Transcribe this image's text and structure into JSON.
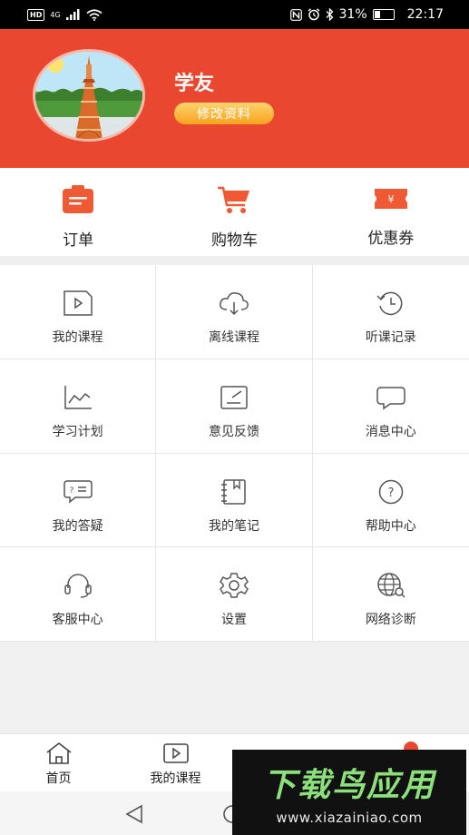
{
  "status_bar": {
    "network": "4G",
    "battery_percent": "31%",
    "battery_level": 0.31,
    "time": "22:17"
  },
  "profile": {
    "username": "学友",
    "edit_label": "修改资料"
  },
  "quick_actions": [
    {
      "label": "订单",
      "icon": "order-icon"
    },
    {
      "label": "购物车",
      "icon": "cart-icon"
    },
    {
      "label": "优惠券",
      "icon": "coupon-icon"
    }
  ],
  "grid": [
    {
      "label": "我的课程",
      "icon": "course-play-icon"
    },
    {
      "label": "离线课程",
      "icon": "cloud-download-icon"
    },
    {
      "label": "听课记录",
      "icon": "history-clock-icon"
    },
    {
      "label": "学习计划",
      "icon": "chart-line-icon"
    },
    {
      "label": "意见反馈",
      "icon": "feedback-edit-icon"
    },
    {
      "label": "消息中心",
      "icon": "message-bubble-icon"
    },
    {
      "label": "我的答疑",
      "icon": "qa-bubble-icon"
    },
    {
      "label": "我的笔记",
      "icon": "notebook-icon"
    },
    {
      "label": "帮助中心",
      "icon": "help-question-icon"
    },
    {
      "label": "客服中心",
      "icon": "headset-icon"
    },
    {
      "label": "设置",
      "icon": "gear-icon"
    },
    {
      "label": "网络诊断",
      "icon": "globe-search-icon"
    }
  ],
  "bottom_nav": [
    {
      "label": "首页",
      "icon": "home-icon"
    },
    {
      "label": "我的课程",
      "icon": "course-play-icon"
    }
  ],
  "watermark": {
    "title": "下载鸟应用",
    "url": "www.xiazainiao.com"
  },
  "colors": {
    "brand": "#e9472f",
    "edit_button": "#f7a31c",
    "watermark_green": "#8be07b"
  }
}
